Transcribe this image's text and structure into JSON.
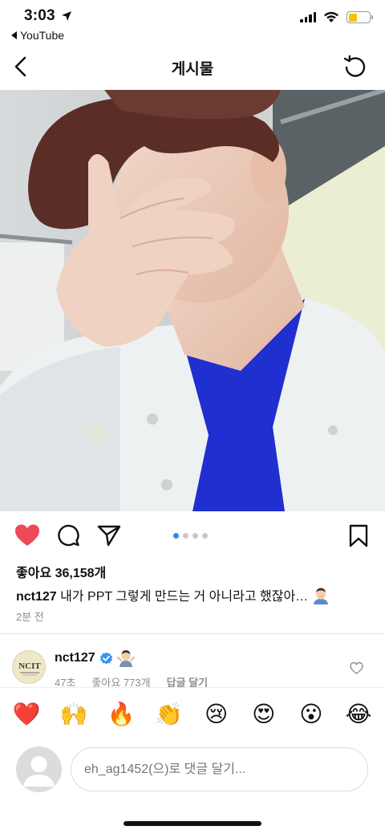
{
  "status": {
    "time": "3:03",
    "back_app": "YouTube"
  },
  "header": {
    "title": "게시물"
  },
  "post": {
    "likes": "좋아요 36,158개",
    "username": "nct127",
    "caption": " 내가 PPT 그렇게 만드는 거 아니라고 했잖아…",
    "time_ago": "2분 전",
    "carousel": {
      "count": 4,
      "active": 1
    }
  },
  "comment": {
    "username": "nct127",
    "avatar_text": "NCIT",
    "time": "47초",
    "likes": "좋아요 773개",
    "reply": "답글 달기"
  },
  "reactions": [
    "❤️",
    "🙌",
    "🔥",
    "👏",
    "😢",
    "😍",
    "😮",
    "😂"
  ],
  "comment_input": {
    "placeholder": "eh_ag1452(으)로 댓글 달기..."
  },
  "colors": {
    "like_red": "#ed4956",
    "accent_blue": "#2a8af0",
    "verified_blue": "#3897f0",
    "battery_yellow": "#f5c400"
  }
}
